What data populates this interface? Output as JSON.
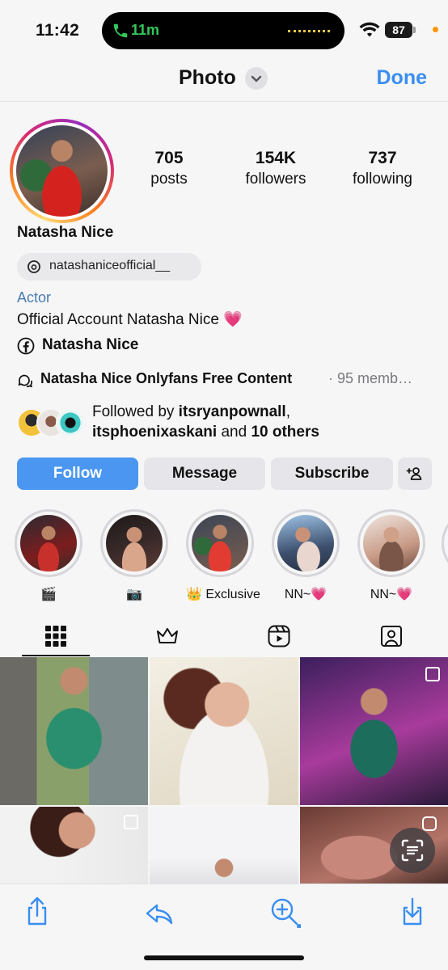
{
  "status_bar": {
    "time": "11:42",
    "call_timer": "11m",
    "battery": "87"
  },
  "nav": {
    "title": "Photo",
    "done_label": "Done"
  },
  "profile": {
    "stats": [
      {
        "count": "705",
        "label": "posts"
      },
      {
        "count": "154K",
        "label": "followers"
      },
      {
        "count": "737",
        "label": "following"
      }
    ],
    "name": "Natasha Nice",
    "threads_handle": "natashaniceofficial__",
    "category": "Actor",
    "bio": "Official Account Natasha Nice",
    "bio_emoji": "💗",
    "facebook_label": "Natasha Nice",
    "channel": {
      "title": "Natasha Nice Onlyfans Free Content",
      "members": "· 95 memb…"
    },
    "followed_by": {
      "prefix": "Followed by ",
      "user1": "itsryanpownall",
      "sep": ",",
      "user2": "itsphoenixaskani",
      "and": " and ",
      "others": "10 others"
    }
  },
  "actions": {
    "follow": "Follow",
    "message": "Message",
    "subscribe": "Subscribe"
  },
  "highlights": [
    {
      "label": "🎬",
      "colors": [
        "#7b1d1d",
        "#c8302b"
      ]
    },
    {
      "label": "📷",
      "colors": [
        "#3a2a2a",
        "#8b5a4c"
      ]
    },
    {
      "label": "👑 Exclusive",
      "colors": [
        "#9c2222",
        "#e23c32"
      ]
    },
    {
      "label": "NN~💗",
      "colors": [
        "#3d4f6e",
        "#b98b77"
      ]
    },
    {
      "label": "NN~💗",
      "colors": [
        "#6d4a3d",
        "#c89a86"
      ]
    }
  ],
  "tabs": [
    "grid-icon",
    "crown-icon",
    "reels-icon",
    "tagged-icon"
  ],
  "colors": {
    "accent": "#3a8ef0",
    "follow_button": "#4a96f0",
    "link_blue": "#4a7ab3"
  }
}
